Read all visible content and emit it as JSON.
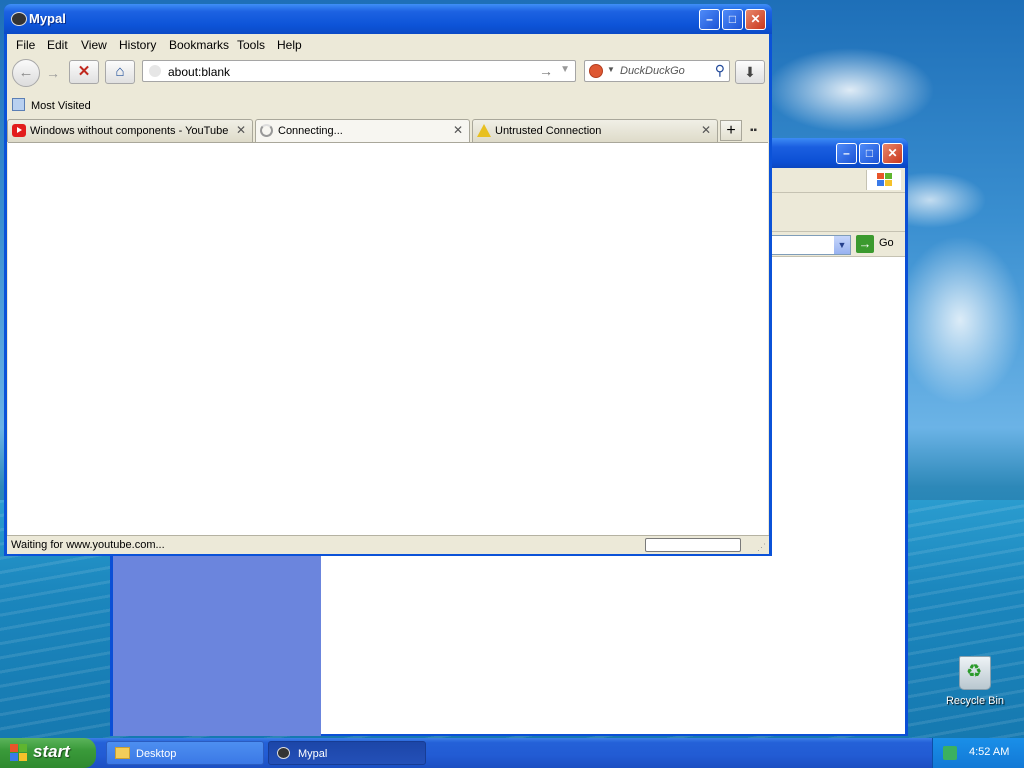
{
  "mypal": {
    "title": "Mypal",
    "menu": [
      "File",
      "Edit",
      "View",
      "History",
      "Bookmarks",
      "Tools",
      "Help"
    ],
    "url": "about:blank",
    "search_placeholder": "DuckDuckGo",
    "bookmarks_toolbar": {
      "item": "Most Visited"
    },
    "tabs": [
      {
        "label": "Windows without components - YouTube",
        "icon": "youtube-icon"
      },
      {
        "label": "Connecting...",
        "icon": "loading-spinner-icon"
      },
      {
        "label": "Untrusted Connection",
        "icon": "warning-icon"
      }
    ],
    "status": "Waiting for www.youtube.com..."
  },
  "ie_window": {
    "go_label": "Go"
  },
  "desktop": {
    "recycle_bin": "Recycle Bin"
  },
  "taskbar": {
    "start": "start",
    "tasks": [
      {
        "label": "Desktop",
        "icon": "folder-icon"
      },
      {
        "label": "Mypal",
        "icon": "mypal-icon"
      }
    ],
    "clock": "4:52 AM"
  },
  "colors": {
    "xp_blue": "#0b52d8",
    "start_green": "#3a9a3a",
    "ie_sidebar": "#6b85dd"
  }
}
